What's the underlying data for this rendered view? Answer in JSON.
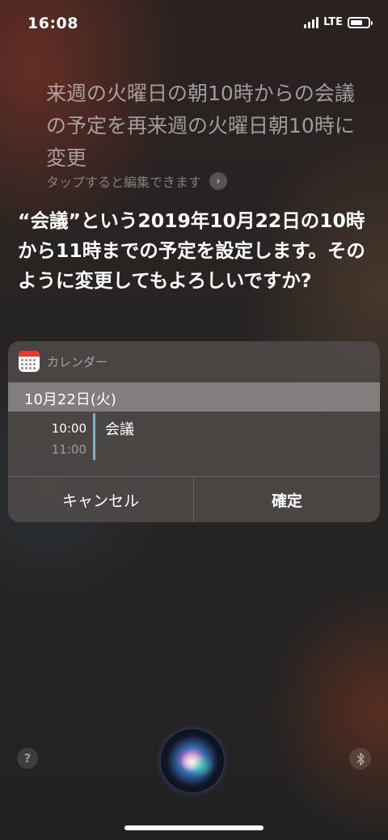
{
  "status_bar": {
    "time": "16:08",
    "network": "LTE",
    "icons": [
      "signal-icon",
      "battery-icon"
    ]
  },
  "query": {
    "text": "来週の火曜日の朝10時からの会議の予定を再来週の火曜日朝10時に変更",
    "tap_to_edit": "タップすると編集できます",
    "icon": "chevron-right-icon"
  },
  "siri_response": "“会議”という2019年10月22日の10時から11時までの予定を設定します。そのように変更してもよろしいですか?",
  "calendar_card": {
    "app_name": "カレンダー",
    "app_icon": "calendar-app-icon",
    "date": "10月22日(火)",
    "event": {
      "start": "10:00",
      "end": "11:00",
      "title": "会議",
      "color": "#68b8d8"
    },
    "buttons": {
      "cancel": "キャンセル",
      "confirm": "確定"
    }
  },
  "bottom": {
    "help_label": "?",
    "icons": [
      "help-icon",
      "siri-orb-icon",
      "bluetooth-icon"
    ]
  }
}
